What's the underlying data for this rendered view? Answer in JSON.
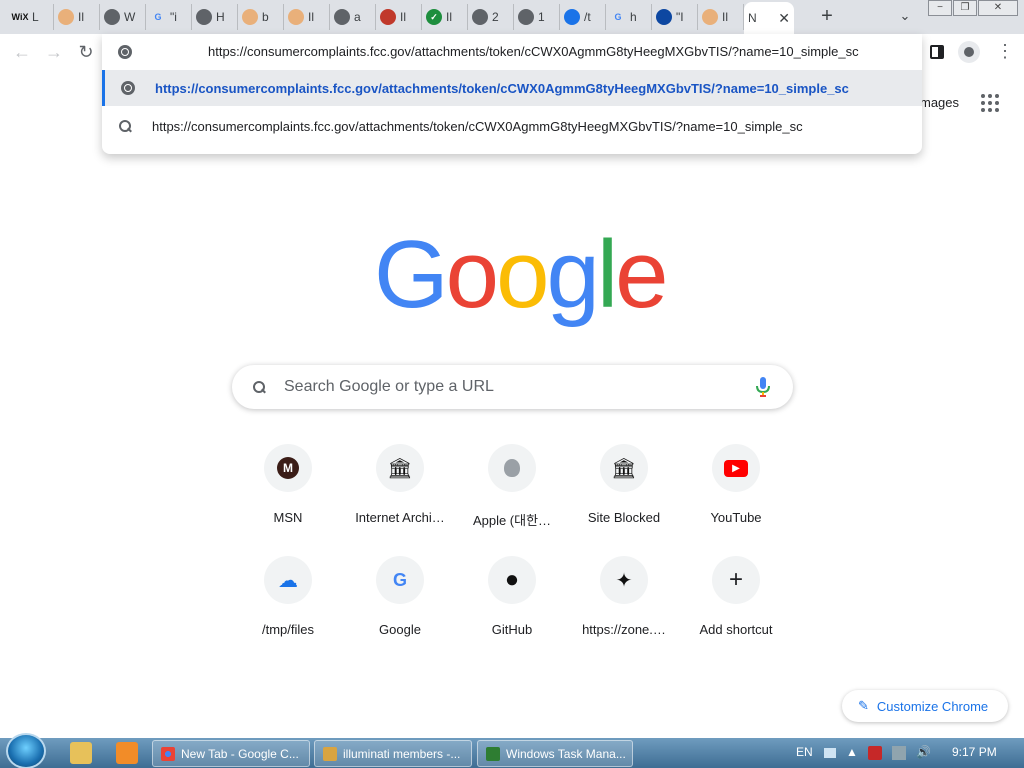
{
  "window_controls": {
    "minimize": "−",
    "restore": "❐",
    "close": "✕"
  },
  "tabs": [
    {
      "label": "L",
      "favicon": "wix",
      "favicon_color": "#111111"
    },
    {
      "label": "Il",
      "favicon": "avatar",
      "favicon_color": "#e9b07a"
    },
    {
      "label": "W",
      "favicon": "globe",
      "favicon_color": "#5f6368"
    },
    {
      "label": "\"i",
      "favicon": "google",
      "favicon_color": "#4285f4"
    },
    {
      "label": "H",
      "favicon": "globe",
      "favicon_color": "#5f6368"
    },
    {
      "label": "b",
      "favicon": "avatar",
      "favicon_color": "#e9b07a"
    },
    {
      "label": "Il",
      "favicon": "avatar",
      "favicon_color": "#e9b07a"
    },
    {
      "label": "a",
      "favicon": "globe",
      "favicon_color": "#5f6368"
    },
    {
      "label": "Il",
      "favicon": "avatar",
      "favicon_color": "#c0392b"
    },
    {
      "label": "Il",
      "favicon": "check",
      "favicon_color": "#1e8e3e"
    },
    {
      "label": "2",
      "favicon": "globe",
      "favicon_color": "#5f6368"
    },
    {
      "label": "1",
      "favicon": "globe",
      "favicon_color": "#5f6368"
    },
    {
      "label": "/t",
      "favicon": "cloud",
      "favicon_color": "#1a73e8"
    },
    {
      "label": "h",
      "favicon": "google",
      "favicon_color": "#4285f4"
    },
    {
      "label": "\"I",
      "favicon": "malwarebytes",
      "favicon_color": "#0d47a1"
    },
    {
      "label": "Il",
      "favicon": "avatar",
      "favicon_color": "#e9b07a"
    },
    {
      "label": "N",
      "favicon": "none",
      "favicon_color": "#ffffff",
      "active": true
    }
  ],
  "new_tab_symbol": "+",
  "tab_search_symbol": "⌄",
  "toolbar": {
    "back": "←",
    "forward": "→",
    "reload": "↻",
    "menu": "⋮"
  },
  "omnibox": {
    "value": "https://consumercomplaints.fcc.gov/attachments/token/cCWX0AgmmG8tyHeegMXGbvTIS/?name=10_simple_sc",
    "suggestions": [
      {
        "text": "https://consumercomplaints.fcc.gov/attachments/token/cCWX0AgmmG8tyHeegMXGbvTIS/?name=10_simple_sc",
        "icon": "globe-icon",
        "selected": true
      },
      {
        "text": "https://consumercomplaints.fcc.gov/attachments/token/cCWX0AgmmG8tyHeegMXGbvTIS/?name=10_simple_sc",
        "icon": "search-icon",
        "selected": false
      }
    ]
  },
  "header": {
    "images_link": "mages"
  },
  "logo": {
    "letters": [
      "G",
      "o",
      "o",
      "g",
      "l",
      "e"
    ],
    "colors": [
      "#4285f4",
      "#ea4335",
      "#fbbc05",
      "#4285f4",
      "#34a853",
      "#ea4335"
    ]
  },
  "search": {
    "placeholder": "Search Google or type a URL"
  },
  "shortcuts": [
    {
      "label": "MSN",
      "icon": "msn-icon",
      "glyph": "M"
    },
    {
      "label": "Internet Archi…",
      "icon": "archive-icon",
      "glyph": "🏛"
    },
    {
      "label": "Apple (대한…",
      "icon": "apple-icon",
      "glyph": ""
    },
    {
      "label": "Site Blocked",
      "icon": "archive-icon",
      "glyph": "🏛"
    },
    {
      "label": "YouTube",
      "icon": "youtube-icon",
      "glyph": "▶"
    },
    {
      "label": "/tmp/files",
      "icon": "cloud-upload-icon",
      "glyph": "☁"
    },
    {
      "label": "Google",
      "icon": "google-icon",
      "glyph": "G"
    },
    {
      "label": "GitHub",
      "icon": "github-icon",
      "glyph": "●"
    },
    {
      "label": "https://zone.…",
      "icon": "zone-icon",
      "glyph": "✦"
    },
    {
      "label": "Add shortcut",
      "icon": "plus-icon",
      "glyph": "+"
    }
  ],
  "customize": {
    "label": "Customize Chrome",
    "icon": "pencil-icon"
  },
  "taskbar": {
    "buttons": [
      {
        "label": "New Tab - Google C...",
        "icon": "chrome-icon"
      },
      {
        "label": "illuminati members -...",
        "icon": "paint-icon"
      },
      {
        "label": "Windows Task Mana...",
        "icon": "task-manager-icon"
      }
    ],
    "language": "EN",
    "time": "9:17 PM"
  }
}
